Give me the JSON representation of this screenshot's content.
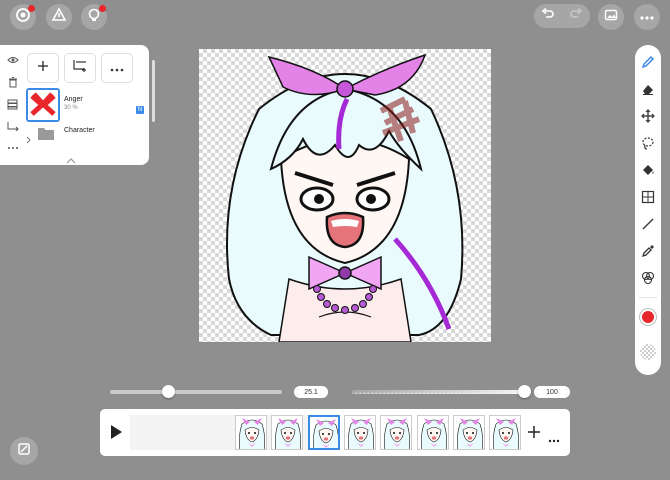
{
  "top_left_icons": [
    {
      "name": "gallery-icon",
      "badge": true
    },
    {
      "name": "adjust-icon",
      "badge": false
    },
    {
      "name": "tips-bulb-icon",
      "badge": true
    }
  ],
  "top_right": {
    "undo_icon": "undo-icon",
    "redo_icon": "redo-icon",
    "image_icon": "image-icon",
    "more_icon": "more-icon"
  },
  "layer_panel": {
    "layers": [
      {
        "name": "Anger",
        "opacity": "30 %",
        "badge": "N"
      },
      {
        "name": "Character",
        "is_folder": true
      }
    ]
  },
  "sliders": {
    "size_value": "25.1",
    "size_fraction": 0.34,
    "opacity_value": "100",
    "opacity_fraction": 1.0
  },
  "toolbar": {
    "tools": [
      "pen-icon",
      "eraser-icon",
      "move-icon",
      "lasso-icon",
      "fill-icon",
      "ruler-icon",
      "line-icon",
      "eyedropper-icon",
      "layer-effect-icon"
    ],
    "active_tool": "pen-icon",
    "color": "#e8262c"
  },
  "timeline": {
    "frames": 8,
    "selected_frame": 3
  },
  "colors": {
    "accent": "#3b8ae6",
    "red": "#e8262c",
    "background": "#8f8f8f"
  }
}
